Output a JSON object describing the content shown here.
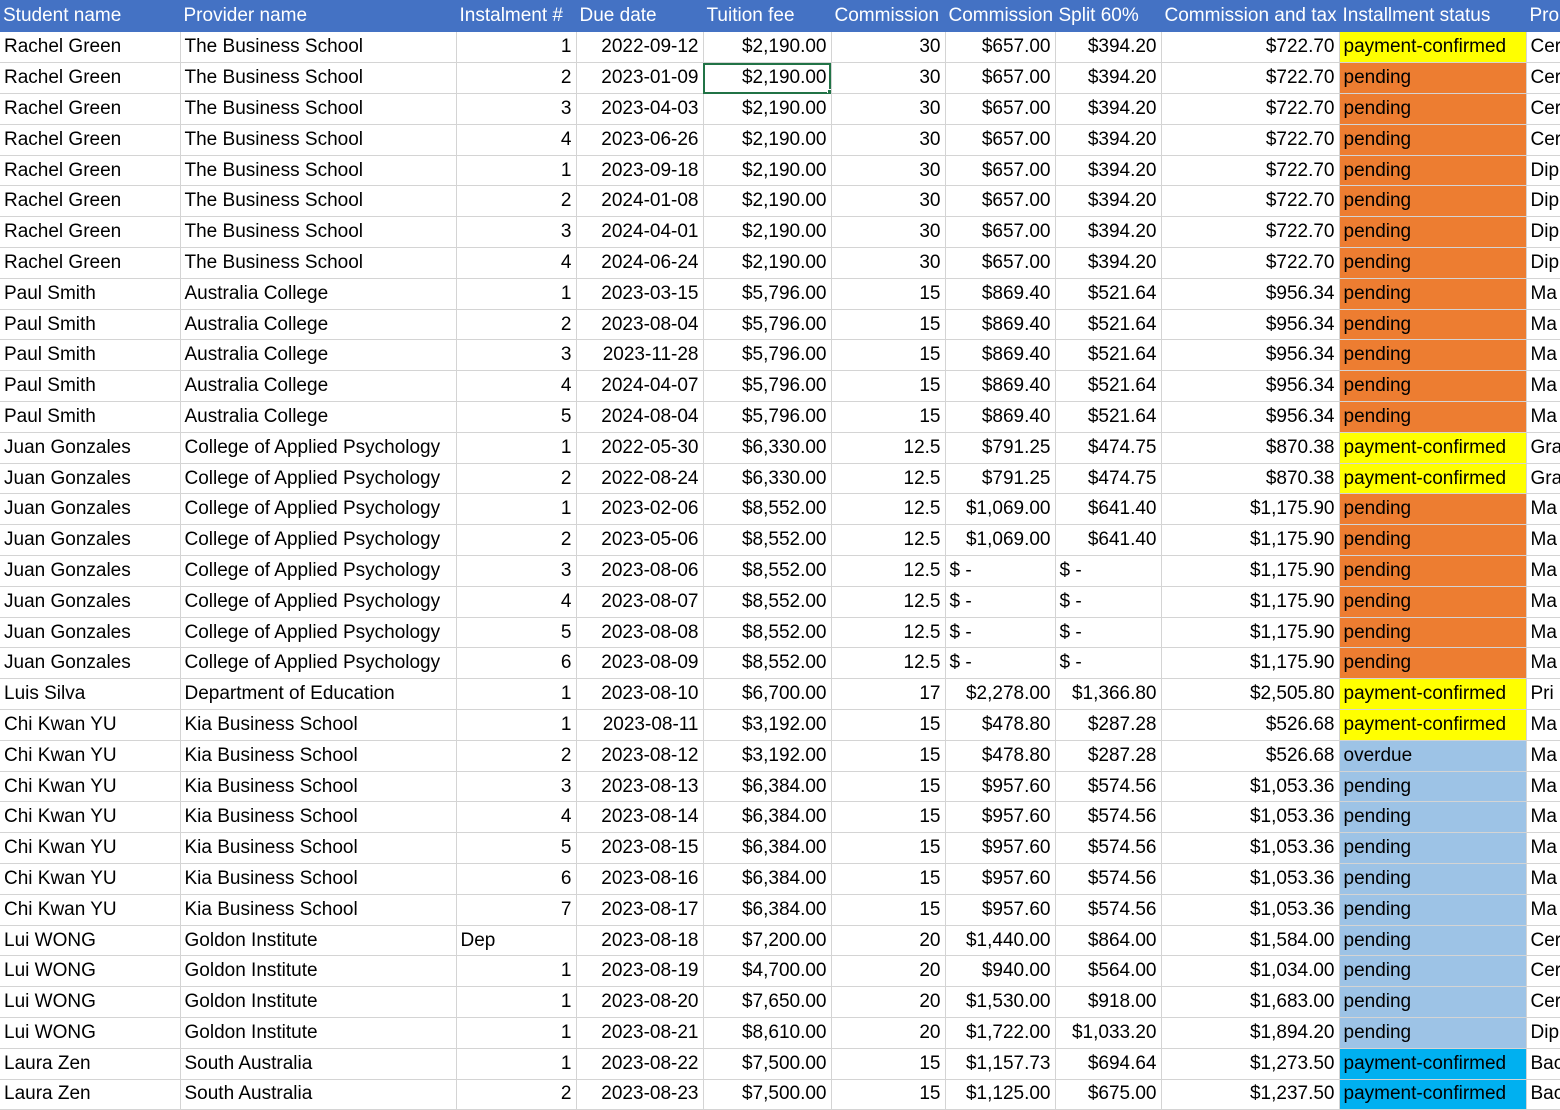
{
  "headers": [
    "Student name",
    "Provider name",
    "Instalment #",
    "Due date",
    "Tuition fee",
    "Commission",
    "Commission",
    "Split 60%",
    "Commission and tax",
    "Installment status",
    "Pro"
  ],
  "status_colors": {
    "yellow": "#ffff00",
    "orange": "#ed7d31",
    "blue": "#9dc3e6",
    "cyan": "#00b0f0",
    "header_blue": "#4472c4"
  },
  "selected_cell": "row 2, Tuition fee",
  "rows": [
    {
      "student": "Rachel Green",
      "provider": "The Business School",
      "instalment": "1",
      "due": "2022-09-12",
      "fee": "$2,190.00",
      "rate": "30",
      "commission": "$657.00",
      "split": "$394.20",
      "tax": "$722.70",
      "status": "payment-confirmed",
      "status_color": "yellow",
      "program": "Cer"
    },
    {
      "student": "Rachel Green",
      "provider": "The Business School",
      "instalment": "2",
      "due": "2023-01-09",
      "fee": "$2,190.00",
      "rate": "30",
      "commission": "$657.00",
      "split": "$394.20",
      "tax": "$722.70",
      "status": "pending",
      "status_color": "orange",
      "program": "Cer"
    },
    {
      "student": "Rachel Green",
      "provider": "The Business School",
      "instalment": "3",
      "due": "2023-04-03",
      "fee": "$2,190.00",
      "rate": "30",
      "commission": "$657.00",
      "split": "$394.20",
      "tax": "$722.70",
      "status": "pending",
      "status_color": "orange",
      "program": "Cer"
    },
    {
      "student": "Rachel Green",
      "provider": "The Business School",
      "instalment": "4",
      "due": "2023-06-26",
      "fee": "$2,190.00",
      "rate": "30",
      "commission": "$657.00",
      "split": "$394.20",
      "tax": "$722.70",
      "status": "pending",
      "status_color": "orange",
      "program": "Cer"
    },
    {
      "student": "Rachel Green",
      "provider": "The Business School",
      "instalment": "1",
      "due": "2023-09-18",
      "fee": "$2,190.00",
      "rate": "30",
      "commission": "$657.00",
      "split": "$394.20",
      "tax": "$722.70",
      "status": "pending",
      "status_color": "orange",
      "program": "Dip"
    },
    {
      "student": "Rachel Green",
      "provider": "The Business School",
      "instalment": "2",
      "due": "2024-01-08",
      "fee": "$2,190.00",
      "rate": "30",
      "commission": "$657.00",
      "split": "$394.20",
      "tax": "$722.70",
      "status": "pending",
      "status_color": "orange",
      "program": "Dip"
    },
    {
      "student": "Rachel Green",
      "provider": "The Business School",
      "instalment": "3",
      "due": "2024-04-01",
      "fee": "$2,190.00",
      "rate": "30",
      "commission": "$657.00",
      "split": "$394.20",
      "tax": "$722.70",
      "status": "pending",
      "status_color": "orange",
      "program": "Dip"
    },
    {
      "student": "Rachel Green",
      "provider": "The Business School",
      "instalment": "4",
      "due": "2024-06-24",
      "fee": "$2,190.00",
      "rate": "30",
      "commission": "$657.00",
      "split": "$394.20",
      "tax": "$722.70",
      "status": "pending",
      "status_color": "orange",
      "program": "Dip"
    },
    {
      "student": "Paul Smith",
      "provider": "Australia College",
      "instalment": "1",
      "due": "2023-03-15",
      "fee": "$5,796.00",
      "rate": "15",
      "commission": "$869.40",
      "split": "$521.64",
      "tax": "$956.34",
      "status": "pending",
      "status_color": "orange",
      "program": "Ma"
    },
    {
      "student": "Paul Smith",
      "provider": "Australia College",
      "instalment": "2",
      "due": "2023-08-04",
      "fee": "$5,796.00",
      "rate": "15",
      "commission": "$869.40",
      "split": "$521.64",
      "tax": "$956.34",
      "status": "pending",
      "status_color": "orange",
      "program": "Ma"
    },
    {
      "student": "Paul Smith",
      "provider": "Australia College",
      "instalment": "3",
      "due": "2023-11-28",
      "fee": "$5,796.00",
      "rate": "15",
      "commission": "$869.40",
      "split": "$521.64",
      "tax": "$956.34",
      "status": "pending",
      "status_color": "orange",
      "program": "Ma"
    },
    {
      "student": "Paul Smith",
      "provider": "Australia College",
      "instalment": "4",
      "due": "2024-04-07",
      "fee": "$5,796.00",
      "rate": "15",
      "commission": "$869.40",
      "split": "$521.64",
      "tax": "$956.34",
      "status": "pending",
      "status_color": "orange",
      "program": "Ma"
    },
    {
      "student": "Paul Smith",
      "provider": "Australia College",
      "instalment": "5",
      "due": "2024-08-04",
      "fee": "$5,796.00",
      "rate": "15",
      "commission": "$869.40",
      "split": "$521.64",
      "tax": "$956.34",
      "status": "pending",
      "status_color": "orange",
      "program": "Ma"
    },
    {
      "student": "Juan Gonzales",
      "provider": "College of Applied Psychology",
      "instalment": "1",
      "due": "2022-05-30",
      "fee": "$6,330.00",
      "rate": "12.5",
      "commission": "$791.25",
      "split": "$474.75",
      "tax": "$870.38",
      "status": "payment-confirmed",
      "status_color": "yellow",
      "program": "Gra"
    },
    {
      "student": "Juan Gonzales",
      "provider": "College of Applied Psychology",
      "instalment": "2",
      "due": "2022-08-24",
      "fee": "$6,330.00",
      "rate": "12.5",
      "commission": "$791.25",
      "split": "$474.75",
      "tax": "$870.38",
      "status": "payment-confirmed",
      "status_color": "yellow",
      "program": "Gra"
    },
    {
      "student": "Juan Gonzales",
      "provider": "College of Applied Psychology",
      "instalment": "1",
      "due": "2023-02-06",
      "fee": "$8,552.00",
      "rate": "12.5",
      "commission": "$1,069.00",
      "split": "$641.40",
      "tax": "$1,175.90",
      "status": "pending",
      "status_color": "orange",
      "program": "Ma"
    },
    {
      "student": "Juan Gonzales",
      "provider": "College of Applied Psychology",
      "instalment": "2",
      "due": "2023-05-06",
      "fee": "$8,552.00",
      "rate": "12.5",
      "commission": "$1,069.00",
      "split": "$641.40",
      "tax": "$1,175.90",
      "status": "pending",
      "status_color": "orange",
      "program": "Ma"
    },
    {
      "student": "Juan Gonzales",
      "provider": "College of Applied Psychology",
      "instalment": "3",
      "due": "2023-08-06",
      "fee": "$8,552.00",
      "rate": "12.5",
      "commission": "$ -",
      "split": "$ -",
      "tax": "$1,175.90",
      "status": "pending",
      "status_color": "orange",
      "program": "Ma"
    },
    {
      "student": "Juan Gonzales",
      "provider": "College of Applied Psychology",
      "instalment": "4",
      "due": "2023-08-07",
      "fee": "$8,552.00",
      "rate": "12.5",
      "commission": "$ -",
      "split": "$ -",
      "tax": "$1,175.90",
      "status": "pending",
      "status_color": "orange",
      "program": "Ma"
    },
    {
      "student": "Juan Gonzales",
      "provider": "College of Applied Psychology",
      "instalment": "5",
      "due": "2023-08-08",
      "fee": "$8,552.00",
      "rate": "12.5",
      "commission": "$ -",
      "split": "$ -",
      "tax": "$1,175.90",
      "status": "pending",
      "status_color": "orange",
      "program": "Ma"
    },
    {
      "student": "Juan Gonzales",
      "provider": "College of Applied Psychology",
      "instalment": "6",
      "due": "2023-08-09",
      "fee": "$8,552.00",
      "rate": "12.5",
      "commission": "$ -",
      "split": "$ -",
      "tax": "$1,175.90",
      "status": "pending",
      "status_color": "orange",
      "program": "Ma"
    },
    {
      "student": "Luis Silva",
      "provider": "Department of Education",
      "instalment": "1",
      "due": "2023-08-10",
      "fee": "$6,700.00",
      "rate": "17",
      "commission": "$2,278.00",
      "split": "$1,366.80",
      "tax": "$2,505.80",
      "status": "payment-confirmed",
      "status_color": "yellow",
      "program": "Pri"
    },
    {
      "student": "Chi Kwan YU",
      "provider": "Kia Business School",
      "instalment": "1",
      "due": "2023-08-11",
      "fee": "$3,192.00",
      "rate": "15",
      "commission": "$478.80",
      "split": "$287.28",
      "tax": "$526.68",
      "status": "payment-confirmed",
      "status_color": "yellow",
      "program": "Ma"
    },
    {
      "student": "Chi Kwan YU",
      "provider": "Kia Business School",
      "instalment": "2",
      "due": "2023-08-12",
      "fee": "$3,192.00",
      "rate": "15",
      "commission": "$478.80",
      "split": "$287.28",
      "tax": "$526.68",
      "status": "overdue",
      "status_color": "blue",
      "program": "Ma"
    },
    {
      "student": "Chi Kwan YU",
      "provider": "Kia Business School",
      "instalment": "3",
      "due": "2023-08-13",
      "fee": "$6,384.00",
      "rate": "15",
      "commission": "$957.60",
      "split": "$574.56",
      "tax": "$1,053.36",
      "status": "pending",
      "status_color": "blue",
      "program": "Ma"
    },
    {
      "student": "Chi Kwan YU",
      "provider": "Kia Business School",
      "instalment": "4",
      "due": "2023-08-14",
      "fee": "$6,384.00",
      "rate": "15",
      "commission": "$957.60",
      "split": "$574.56",
      "tax": "$1,053.36",
      "status": "pending",
      "status_color": "blue",
      "program": "Ma"
    },
    {
      "student": "Chi Kwan YU",
      "provider": "Kia Business School",
      "instalment": "5",
      "due": "2023-08-15",
      "fee": "$6,384.00",
      "rate": "15",
      "commission": "$957.60",
      "split": "$574.56",
      "tax": "$1,053.36",
      "status": "pending",
      "status_color": "blue",
      "program": "Ma"
    },
    {
      "student": "Chi Kwan YU",
      "provider": "Kia Business School",
      "instalment": "6",
      "due": "2023-08-16",
      "fee": "$6,384.00",
      "rate": "15",
      "commission": "$957.60",
      "split": "$574.56",
      "tax": "$1,053.36",
      "status": "pending",
      "status_color": "blue",
      "program": "Ma"
    },
    {
      "student": "Chi Kwan YU",
      "provider": "Kia Business School",
      "instalment": "7",
      "due": "2023-08-17",
      "fee": "$6,384.00",
      "rate": "15",
      "commission": "$957.60",
      "split": "$574.56",
      "tax": "$1,053.36",
      "status": "pending",
      "status_color": "blue",
      "program": "Ma"
    },
    {
      "student": "Lui WONG",
      "provider": "Goldon Institute",
      "instalment": "Dep",
      "due": "2023-08-18",
      "fee": "$7,200.00",
      "rate": "20",
      "commission": "$1,440.00",
      "split": "$864.00",
      "tax": "$1,584.00",
      "status": "pending",
      "status_color": "blue",
      "program": "Cer"
    },
    {
      "student": "Lui WONG",
      "provider": "Goldon Institute",
      "instalment": "1",
      "due": "2023-08-19",
      "fee": "$4,700.00",
      "rate": "20",
      "commission": "$940.00",
      "split": "$564.00",
      "tax": "$1,034.00",
      "status": "pending",
      "status_color": "blue",
      "program": "Cer"
    },
    {
      "student": "Lui WONG",
      "provider": "Goldon Institute",
      "instalment": "1",
      "due": "2023-08-20",
      "fee": "$7,650.00",
      "rate": "20",
      "commission": "$1,530.00",
      "split": "$918.00",
      "tax": "$1,683.00",
      "status": "pending",
      "status_color": "blue",
      "program": "Cer"
    },
    {
      "student": "Lui WONG",
      "provider": "Goldon Institute",
      "instalment": "1",
      "due": "2023-08-21",
      "fee": "$8,610.00",
      "rate": "20",
      "commission": "$1,722.00",
      "split": "$1,033.20",
      "tax": "$1,894.20",
      "status": "pending",
      "status_color": "blue",
      "program": "Dip"
    },
    {
      "student": "Laura Zen",
      "provider": " South Australia",
      "instalment": "1",
      "due": "2023-08-22",
      "fee": "$7,500.00",
      "rate": "15",
      "commission": "$1,157.73",
      "split": "$694.64",
      "tax": "$1,273.50",
      "status": "payment-confirmed",
      "status_color": "cyan",
      "program": "Bac"
    },
    {
      "student": "Laura Zen",
      "provider": " South Australia",
      "instalment": "2",
      "due": "2023-08-23",
      "fee": "$7,500.00",
      "rate": "15",
      "commission": "$1,125.00",
      "split": "$675.00",
      "tax": "$1,237.50",
      "status": "payment-confirmed",
      "status_color": "cyan",
      "program": "Bac"
    }
  ]
}
